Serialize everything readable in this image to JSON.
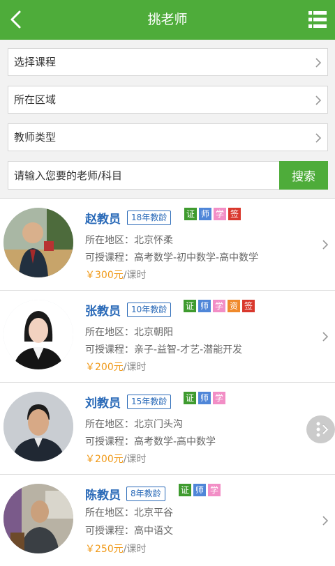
{
  "header": {
    "title": "挑老师"
  },
  "filters": [
    {
      "label": "选择课程"
    },
    {
      "label": "所在区域"
    },
    {
      "label": "教师类型"
    }
  ],
  "search": {
    "placeholder": "请输入您要的老师/科目",
    "button_label": "搜索"
  },
  "badge_colors": {
    "证": "#3f9b2f",
    "师": "#4f86d8",
    "学": "#f28ec6",
    "资": "#f08a2c",
    "签": "#d9382d"
  },
  "teachers": [
    {
      "name": "赵教员",
      "years": "18年教龄",
      "badges": [
        "证",
        "师",
        "学",
        "签"
      ],
      "region_label": "所在地区：",
      "region": "北京怀柔",
      "courses_label": "可授课程：",
      "courses": "高考数学-初中数学-高中数学",
      "price": "￥300元",
      "price_unit": "/课时"
    },
    {
      "name": "张教员",
      "years": "10年教龄",
      "badges": [
        "证",
        "师",
        "学",
        "资",
        "签"
      ],
      "region_label": "所在地区：",
      "region": "北京朝阳",
      "courses_label": "可授课程：",
      "courses": "亲子-益智-才艺-潜能开发",
      "price": "￥200元",
      "price_unit": "/课时"
    },
    {
      "name": "刘教员",
      "years": "15年教龄",
      "badges": [
        "证",
        "师",
        "学"
      ],
      "region_label": "所在地区：",
      "region": "北京门头沟",
      "courses_label": "可授课程：",
      "courses": "高考数学-高中数学",
      "price": "￥200元",
      "price_unit": "/课时"
    },
    {
      "name": "陈教员",
      "years": "8年教龄",
      "badges": [
        "证",
        "师",
        "学"
      ],
      "region_label": "所在地区：",
      "region": "北京平谷",
      "courses_label": "可授课程：",
      "courses": "高中语文",
      "price": "￥250元",
      "price_unit": "/课时"
    }
  ]
}
